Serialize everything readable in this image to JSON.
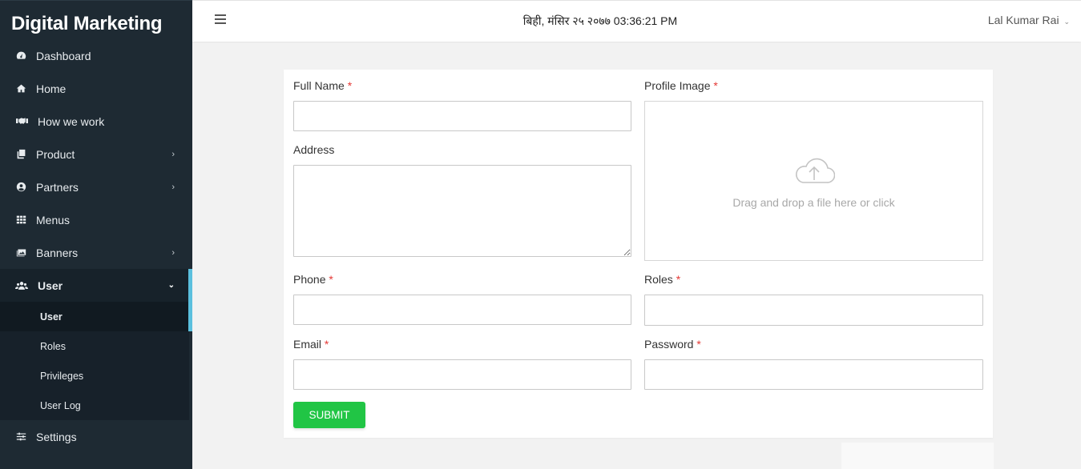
{
  "sidebar": {
    "brand": "Digital Marketing",
    "items": [
      {
        "label": "Dashboard",
        "icon": "dashboard-icon"
      },
      {
        "label": "Home",
        "icon": "home-icon"
      },
      {
        "label": "How we work",
        "icon": "handshake-icon"
      },
      {
        "label": "Product",
        "icon": "copy-icon",
        "has_children": true
      },
      {
        "label": "Partners",
        "icon": "user-circle-icon",
        "has_children": true
      },
      {
        "label": "Menus",
        "icon": "grid-icon"
      },
      {
        "label": "Banners",
        "icon": "image-icon",
        "has_children": true
      },
      {
        "label": "User",
        "icon": "users-icon",
        "expanded": true
      },
      {
        "label": "Settings",
        "icon": "sliders-icon"
      }
    ],
    "user_submenu": [
      {
        "label": "User",
        "current": true
      },
      {
        "label": "Roles"
      },
      {
        "label": "Privileges"
      },
      {
        "label": "User Log"
      }
    ],
    "accent_color": "#5bc0de"
  },
  "topbar": {
    "datetime": "बिही, मंसिर २५ २०७७ 03:36:21 PM",
    "user_name": "Lal Kumar Rai"
  },
  "form": {
    "full_name": {
      "label": "Full Name",
      "required_mark": "*",
      "value": ""
    },
    "profile_image": {
      "label": "Profile Image",
      "required_mark": "*",
      "dropzone_text": "Drag and drop a file here or click"
    },
    "address": {
      "label": "Address",
      "value": ""
    },
    "phone": {
      "label": "Phone",
      "required_mark": "*",
      "value": ""
    },
    "roles": {
      "label": "Roles",
      "required_mark": "*",
      "value": ""
    },
    "email": {
      "label": "Email",
      "required_mark": "*",
      "value": ""
    },
    "password": {
      "label": "Password",
      "required_mark": "*",
      "value": ""
    },
    "submit_label": "SUBMIT",
    "submit_color": "#21c545"
  }
}
